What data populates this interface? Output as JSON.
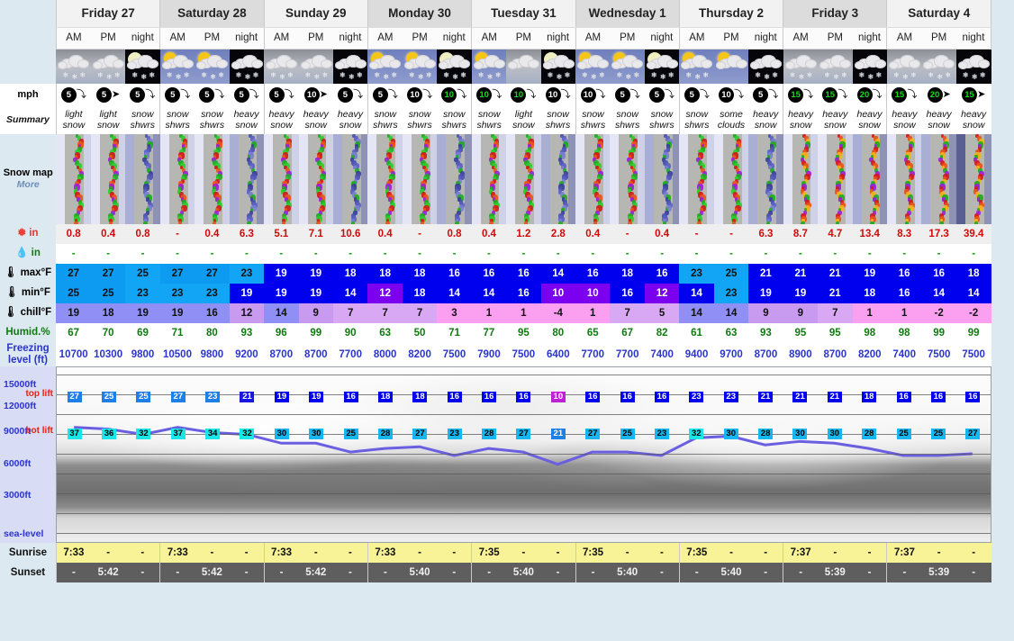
{
  "labels": {
    "mph": "mph",
    "summary": "Summary",
    "snow_map": "Snow map",
    "snow_map_more": "More",
    "snow_in": "in",
    "rain_in": "in",
    "max_f": "max°F",
    "min_f": "min°F",
    "chill_f": "chill°F",
    "humidity": "Humid.%",
    "freezing_level": "Freezing level (ft)",
    "sunrise": "Sunrise",
    "sunset": "Sunset"
  },
  "chart_axis": {
    "t15000": "15000ft",
    "t12000": "12000ft",
    "t9000": "9000ft",
    "t6000": "6000ft",
    "t3000": "3000ft",
    "sea": "sea-level",
    "top_lift": "top lift",
    "bot_lift": "bot lift"
  },
  "days": [
    {
      "name": "Friday 27",
      "periods": [
        "AM",
        "PM",
        "night"
      ]
    },
    {
      "name": "Saturday 28",
      "periods": [
        "AM",
        "PM",
        "night"
      ]
    },
    {
      "name": "Sunday 29",
      "periods": [
        "AM",
        "PM",
        "night"
      ]
    },
    {
      "name": "Monday 30",
      "periods": [
        "AM",
        "PM",
        "night"
      ]
    },
    {
      "name": "Tuesday 31",
      "periods": [
        "AM",
        "PM",
        "night"
      ]
    },
    {
      "name": "Wednesday 1",
      "periods": [
        "AM",
        "PM",
        "night"
      ]
    },
    {
      "name": "Thursday 2",
      "periods": [
        "AM",
        "PM",
        "night"
      ]
    },
    {
      "name": "Friday 3",
      "periods": [
        "AM",
        "PM",
        "night"
      ]
    },
    {
      "name": "Saturday 4",
      "periods": [
        "AM",
        "PM",
        "night"
      ]
    }
  ],
  "chart_data": {
    "type": "table",
    "title": "9-day snow forecast",
    "columns": 27,
    "wind_mph": [
      "5",
      "5",
      "5",
      "5",
      "5",
      "5",
      "5",
      "10",
      "5",
      "5",
      "10",
      "10",
      "10",
      "10",
      "10",
      "10",
      "5",
      "5",
      "5",
      "10",
      "5",
      "15",
      "15",
      "20",
      "15",
      "20",
      "15"
    ],
    "wind_high": [
      false,
      false,
      false,
      false,
      false,
      false,
      false,
      false,
      false,
      false,
      false,
      true,
      true,
      true,
      false,
      false,
      false,
      false,
      false,
      false,
      false,
      true,
      true,
      true,
      true,
      true,
      true
    ],
    "wind_arrow_right": [
      false,
      true,
      false,
      false,
      false,
      false,
      false,
      true,
      false,
      false,
      false,
      false,
      false,
      false,
      false,
      false,
      false,
      false,
      false,
      false,
      false,
      false,
      false,
      false,
      false,
      true,
      true
    ],
    "summary": [
      "light snow",
      "light snow",
      "snow shwrs",
      "snow shwrs",
      "snow shwrs",
      "heavy snow",
      "heavy snow",
      "heavy snow",
      "heavy snow",
      "snow shwrs",
      "snow shwrs",
      "snow shwrs",
      "snow shwrs",
      "light snow",
      "snow shwrs",
      "snow shwrs",
      "snow shwrs",
      "snow shwrs",
      "snow shwrs",
      "some clouds",
      "heavy snow",
      "heavy snow",
      "heavy snow",
      "heavy snow",
      "heavy snow",
      "heavy snow",
      "heavy snow"
    ],
    "icons": [
      "cloud-snow-day",
      "cloud-snow-day",
      "moon-cloud-snow-night",
      "sun-cloud-snow-day",
      "sun-cloud-snow-day",
      "cloud-snow-night",
      "cloud-snow-day",
      "cloud-snow-day",
      "cloud-snow-night",
      "sun-cloud-snow-day",
      "sun-cloud-snow-day",
      "moon-cloud-snow-night",
      "sun-cloud-snow-day",
      "cloud-day",
      "moon-cloud-snow-night",
      "sun-cloud-snow-day",
      "sun-cloud-snow-day",
      "moon-cloud-snow-night",
      "sun-cloud-snow-day",
      "sun-cloud-day",
      "cloud-snow-night",
      "cloud-snow-day",
      "cloud-snow-day",
      "cloud-snow-night",
      "cloud-snow-day",
      "cloud-snow-day",
      "cloud-snow-night"
    ],
    "snow_in": [
      "0.8",
      "0.4",
      "0.8",
      "-",
      "0.4",
      "6.3",
      "5.1",
      "7.1",
      "10.6",
      "0.4",
      "-",
      "0.8",
      "0.4",
      "1.2",
      "2.8",
      "0.4",
      "-",
      "0.4",
      "-",
      "-",
      "6.3",
      "8.7",
      "4.7",
      "13.4",
      "8.3",
      "17.3",
      "39.4"
    ],
    "rain_in": [
      "-",
      "-",
      "-",
      "-",
      "-",
      "-",
      "-",
      "-",
      "-",
      "-",
      "-",
      "-",
      "-",
      "-",
      "-",
      "-",
      "-",
      "-",
      "-",
      "-",
      "-",
      "-",
      "-",
      "-",
      "-",
      "-",
      "-"
    ],
    "max_f": [
      "27",
      "27",
      "25",
      "27",
      "27",
      "23",
      "19",
      "19",
      "18",
      "18",
      "18",
      "16",
      "16",
      "16",
      "14",
      "16",
      "18",
      "16",
      "23",
      "25",
      "21",
      "21",
      "21",
      "19",
      "16",
      "16",
      "18"
    ],
    "min_f": [
      "25",
      "25",
      "23",
      "23",
      "23",
      "19",
      "19",
      "19",
      "14",
      "12",
      "18",
      "14",
      "14",
      "16",
      "10",
      "10",
      "16",
      "12",
      "14",
      "23",
      "19",
      "19",
      "21",
      "18",
      "16",
      "14",
      "14"
    ],
    "chill_f": [
      "19",
      "18",
      "19",
      "19",
      "16",
      "12",
      "14",
      "9",
      "7",
      "7",
      "7",
      "3",
      "1",
      "1",
      "-4",
      "1",
      "7",
      "5",
      "14",
      "14",
      "9",
      "9",
      "7",
      "1",
      "1",
      "-2",
      "-2"
    ],
    "humidity": [
      "67",
      "70",
      "69",
      "71",
      "80",
      "93",
      "96",
      "99",
      "90",
      "63",
      "50",
      "71",
      "77",
      "95",
      "80",
      "65",
      "67",
      "82",
      "61",
      "63",
      "93",
      "95",
      "95",
      "98",
      "98",
      "99",
      "99"
    ],
    "freezing_level_ft": [
      "10700",
      "10300",
      "9800",
      "10500",
      "9800",
      "9200",
      "8700",
      "8700",
      "7700",
      "8000",
      "8200",
      "7500",
      "7900",
      "7500",
      "6400",
      "7700",
      "7700",
      "7400",
      "9400",
      "9700",
      "8700",
      "8900",
      "8700",
      "8200",
      "7400",
      "7500",
      "7500"
    ],
    "top_lift_temp": [
      "27",
      "25",
      "25",
      "27",
      "23",
      "21",
      "19",
      "19",
      "16",
      "18",
      "18",
      "16",
      "16",
      "16",
      "10",
      "16",
      "16",
      "16",
      "23",
      "23",
      "21",
      "21",
      "21",
      "18",
      "16",
      "16",
      "16"
    ],
    "top_lift_color": [
      "b1",
      "b1",
      "b1",
      "b1",
      "b1",
      "b2",
      "b3",
      "b3",
      "b3",
      "b3",
      "b3",
      "b3",
      "b3",
      "b3",
      "m",
      "b3",
      "b3",
      "b3",
      "b3",
      "b3",
      "b3",
      "b3",
      "b3",
      "b3",
      "b3",
      "b3",
      "b3"
    ],
    "bot_lift_temp": [
      "37",
      "36",
      "32",
      "37",
      "34",
      "32",
      "30",
      "30",
      "25",
      "28",
      "27",
      "23",
      "28",
      "27",
      "21",
      "27",
      "25",
      "23",
      "32",
      "30",
      "28",
      "30",
      "30",
      "28",
      "25",
      "25",
      "27"
    ],
    "bot_lift_color": [
      "c1",
      "c1",
      "c1",
      "c1",
      "c1",
      "c1",
      "c2",
      "c2",
      "c2",
      "c2",
      "c2",
      "c2",
      "c2",
      "c2",
      "c3",
      "c2",
      "c2",
      "c2",
      "c1",
      "c2",
      "c2",
      "c2",
      "c2",
      "c2",
      "c2",
      "c2",
      "c2"
    ],
    "freeze_line_pct": [
      34,
      35,
      38,
      34,
      37,
      38,
      43,
      43,
      48,
      46,
      45,
      50,
      46,
      48,
      55,
      48,
      48,
      50,
      40,
      39,
      44,
      42,
      43,
      46,
      50,
      50,
      49
    ],
    "sunrise": [
      "7:33",
      "-",
      "-",
      "7:33",
      "-",
      "-",
      "7:33",
      "-",
      "-",
      "7:33",
      "-",
      "-",
      "7:35",
      "-",
      "-",
      "7:35",
      "-",
      "-",
      "7:35",
      "-",
      "-",
      "7:37",
      "-",
      "-",
      "7:37",
      "-",
      "-"
    ],
    "sunset": [
      "-",
      "5:42",
      "-",
      "-",
      "5:42",
      "-",
      "-",
      "5:42",
      "-",
      "-",
      "5:40",
      "-",
      "-",
      "5:40",
      "-",
      "-",
      "5:40",
      "-",
      "-",
      "5:40",
      "-",
      "-",
      "5:39",
      "-",
      "-",
      "5:39",
      "-"
    ]
  },
  "colors": {
    "snow_text": "#d00a0a",
    "rain_text": "#0a9c0a",
    "humidity_text": "#107a10",
    "freezing_text": "#2b35cc",
    "sunrise_bg": "#f8f396",
    "sunset_bg": "#5e5e5e",
    "page_bg": "#dce9f0"
  }
}
